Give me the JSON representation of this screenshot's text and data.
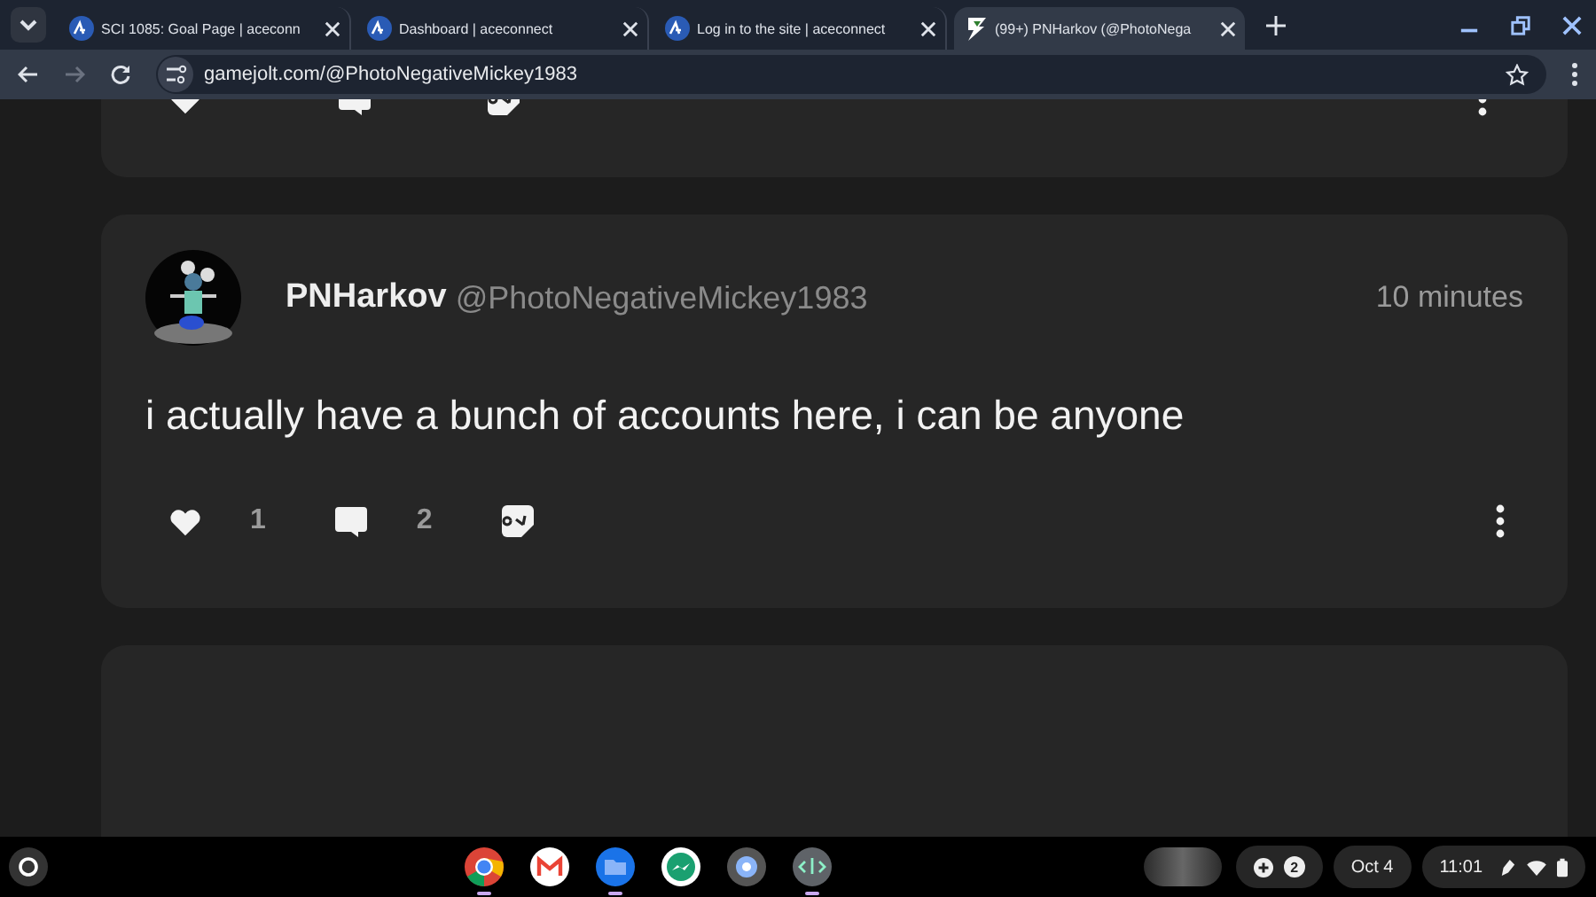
{
  "browser": {
    "tabs": [
      {
        "title": "SCI 1085: Goal Page | aceconn",
        "kind": "ace",
        "selected": false
      },
      {
        "title": "Dashboard | aceconnect",
        "kind": "ace",
        "selected": false
      },
      {
        "title": "Log in to the site | aceconnect",
        "kind": "ace",
        "selected": false
      },
      {
        "title": "(99+) PNHarkov (@PhotoNega",
        "kind": "gamejolt",
        "selected": true
      }
    ],
    "url": "gamejolt.com/@PhotoNegativeMickey1983"
  },
  "posts": [
    {
      "kind": "cut"
    },
    {
      "kind": "full",
      "display_name": "PNHarkov",
      "username": "@PhotoNegativeMickey1983",
      "time": "10 minutes",
      "text": "i actually have a bunch of accounts here, i can be anyone",
      "likes": "1",
      "comments": "2"
    },
    {
      "kind": "empty"
    }
  ],
  "shelf": {
    "apps": [
      {
        "kind": "chrome",
        "running": true
      },
      {
        "kind": "gmail",
        "running": false
      },
      {
        "kind": "files",
        "running": true
      },
      {
        "kind": "messenger",
        "running": false
      },
      {
        "kind": "settings",
        "running": false
      },
      {
        "kind": "terminal",
        "running": true
      }
    ],
    "notifications": "2",
    "date": "Oct 4",
    "time": "11:01"
  }
}
